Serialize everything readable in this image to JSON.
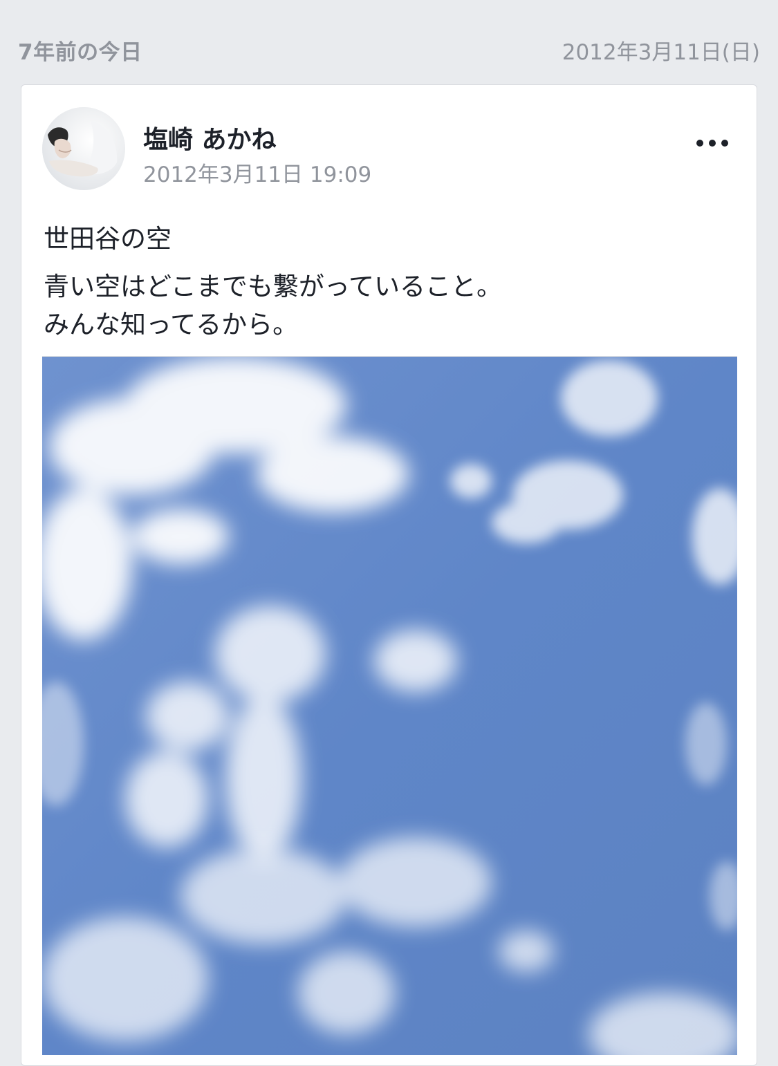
{
  "memory": {
    "label": "7年前の今日",
    "date": "2012年3月11日(日)"
  },
  "post": {
    "author_name": "塩崎 あかね",
    "timestamp": "2012年3月11日 19:09",
    "title": "世田谷の空",
    "body_lines": [
      "青い空はどこまでも繋がっていること。",
      "みんな知ってるから。"
    ],
    "more_icon": "more-horizontal-icon",
    "photo_subject": "blue sky with white clouds"
  },
  "colors": {
    "background": "#e9ebee",
    "card": "#ffffff",
    "secondary_text": "#90949c",
    "primary_text": "#1d2129",
    "sky": "#5f86c8"
  }
}
